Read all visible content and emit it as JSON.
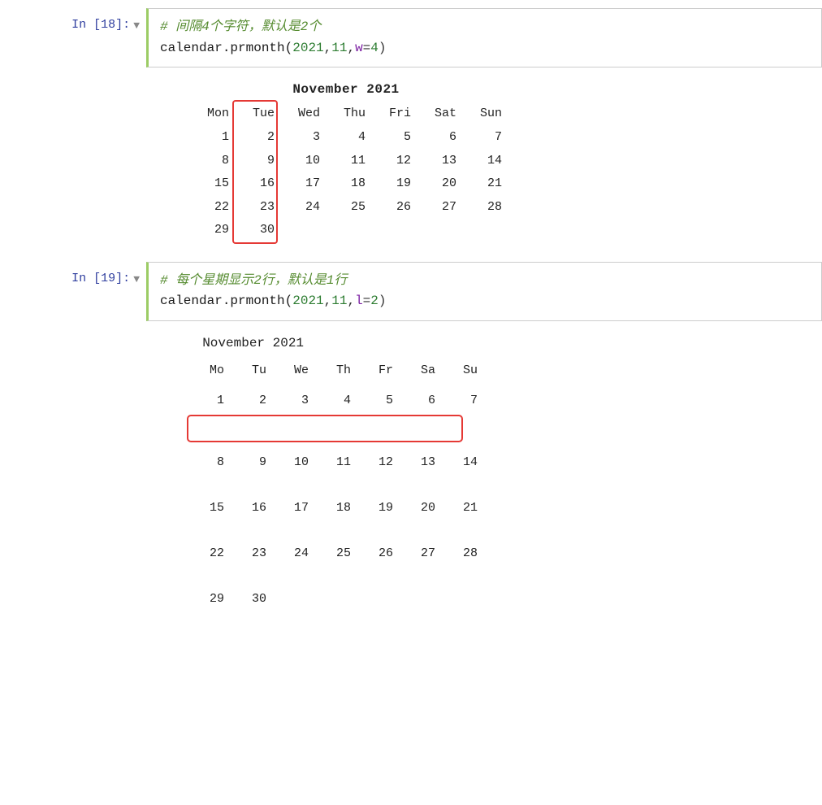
{
  "cell18": {
    "label": "In [18]:",
    "comment": "# 间隔4个字符，默认是2个",
    "code": "calendar.prmonth(2021,11,w=4)",
    "code_parts": {
      "func": "calendar.prmonth(",
      "args": "2021",
      "comma1": ",",
      "n2": "11",
      "comma2": ",",
      "kw": "w",
      "eq": "=",
      "val": "4",
      "close": ")"
    }
  },
  "cal1": {
    "title": "November 2021",
    "headers": [
      "Mon",
      "Tue",
      "Wed",
      "Thu",
      "Fri",
      "Sat",
      "Sun"
    ],
    "rows": [
      [
        "1",
        "2",
        "3",
        "4",
        "5",
        "6",
        "7"
      ],
      [
        "8",
        "9",
        "10",
        "11",
        "12",
        "13",
        "14"
      ],
      [
        "15",
        "16",
        "17",
        "18",
        "19",
        "20",
        "21"
      ],
      [
        "22",
        "23",
        "24",
        "25",
        "26",
        "27",
        "28"
      ],
      [
        "29",
        "30",
        "",
        "",
        "",
        "",
        ""
      ]
    ]
  },
  "cell19": {
    "label": "In [19]:",
    "comment": "# 每个星期显示2行，默认是1行",
    "code": "calendar.prmonth(2021,11,l=2)",
    "code_parts": {
      "func": "calendar.prmonth(",
      "args": "2021",
      "comma1": ",",
      "n2": "11",
      "comma2": ",",
      "kw": "l",
      "eq": "=",
      "val": "2",
      "close": ")"
    }
  },
  "cal2": {
    "title": "November 2021",
    "headers": [
      "Mo",
      "Tu",
      "We",
      "Th",
      "Fr",
      "Sa",
      "Su"
    ],
    "weeks": [
      {
        "row1": [
          "1",
          "2",
          "3",
          "4",
          "5",
          "6",
          "7"
        ],
        "row2": []
      },
      {
        "row1": [
          "8",
          "9",
          "10",
          "11",
          "12",
          "13",
          "14"
        ],
        "row2": []
      },
      {
        "row1": [
          "15",
          "16",
          "17",
          "18",
          "19",
          "20",
          "21"
        ],
        "row2": []
      },
      {
        "row1": [
          "22",
          "23",
          "24",
          "25",
          "26",
          "27",
          "28"
        ],
        "row2": []
      },
      {
        "row1": [
          "29",
          "30",
          "",
          "",
          "",
          "",
          ""
        ],
        "row2": []
      }
    ]
  }
}
